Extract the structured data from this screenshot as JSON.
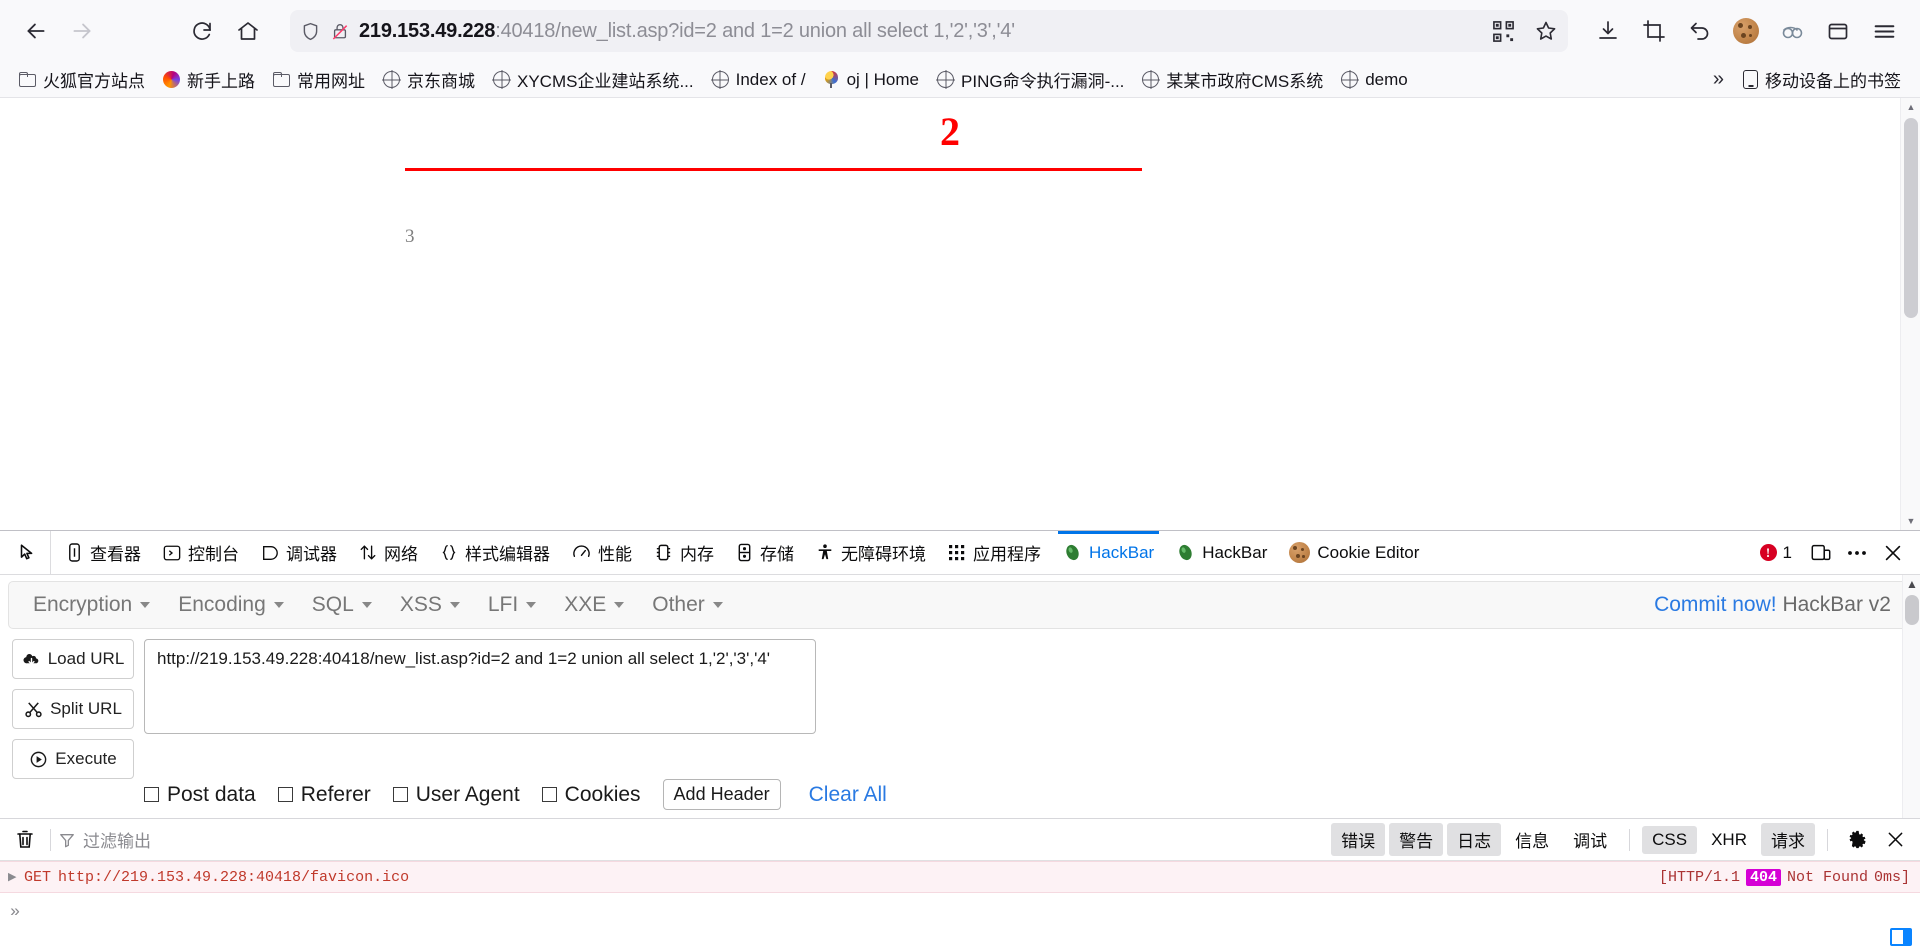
{
  "browser": {
    "url_host": "219.153.49.228",
    "url_rest": ":40418/new_list.asp?id=2 and 1=2 union all select 1,'2','3','4'",
    "back_label": "Back",
    "forward_label": "Forward",
    "reload_label": "Reload",
    "home_label": "Home",
    "downloads_label": "Downloads",
    "screenshot_label": "Take screenshot",
    "undo_label": "Undo close tab",
    "cookie_label": "Cookie Editor",
    "proxy_label": "Proxy",
    "container_label": "Containers",
    "menu_label": "Open application menu",
    "qr_label": "QR code",
    "bookmark_star_label": "Bookmark this page"
  },
  "bookmarks": {
    "items": [
      {
        "label": "火狐官方站点",
        "icon": "folder-icon"
      },
      {
        "label": "新手上路",
        "icon": "firefox-icon"
      },
      {
        "label": "常用网址",
        "icon": "folder-icon"
      },
      {
        "label": "京东商城",
        "icon": "globe-icon"
      },
      {
        "label": "XYCMS企业建站系统...",
        "icon": "globe-icon"
      },
      {
        "label": "Index of /",
        "icon": "globe-icon"
      },
      {
        "label": "oj | Home",
        "icon": "balloon-icon"
      },
      {
        "label": "PING命令执行漏洞-...",
        "icon": "globe-icon"
      },
      {
        "label": "某某市政府CMS系统",
        "icon": "globe-icon"
      },
      {
        "label": "demo",
        "icon": "globe-icon"
      }
    ],
    "overflow_label": "»",
    "mobile_label": "移动设备上的书签"
  },
  "page": {
    "heading": "2",
    "body_text": "3"
  },
  "devtools": {
    "tabs": [
      {
        "label": "查看器",
        "icon": "inspector-icon",
        "active": false
      },
      {
        "label": "控制台",
        "icon": "console-icon",
        "active": false
      },
      {
        "label": "调试器",
        "icon": "debugger-icon",
        "active": false
      },
      {
        "label": "网络",
        "icon": "network-icon",
        "active": false
      },
      {
        "label": "样式编辑器",
        "icon": "style-editor-icon",
        "active": false
      },
      {
        "label": "性能",
        "icon": "performance-icon",
        "active": false
      },
      {
        "label": "内存",
        "icon": "memory-icon",
        "active": false
      },
      {
        "label": "存储",
        "icon": "storage-icon",
        "active": false
      },
      {
        "label": "无障碍环境",
        "icon": "accessibility-icon",
        "active": false
      },
      {
        "label": "应用程序",
        "icon": "application-icon",
        "active": false
      },
      {
        "label": "HackBar",
        "icon": "hackbar-icon",
        "active": true
      },
      {
        "label": "HackBar",
        "icon": "hackbar-icon",
        "active": false
      },
      {
        "label": "Cookie Editor",
        "icon": "cookie-icon",
        "active": false
      }
    ],
    "error_count": "1",
    "picker_label": "选择元素",
    "responsive_label": "响应式设计模式",
    "meatball_label": "自定义工具并获取帮助",
    "close_label": "关闭开发者工具"
  },
  "hackbar": {
    "menu": [
      {
        "label": "Encryption"
      },
      {
        "label": "Encoding"
      },
      {
        "label": "SQL"
      },
      {
        "label": "XSS"
      },
      {
        "label": "LFI"
      },
      {
        "label": "XXE"
      },
      {
        "label": "Other"
      }
    ],
    "commit_link": "Commit now!",
    "commit_suffix": "HackBar v2",
    "buttons": [
      {
        "label": "Load URL",
        "icon": "load-url-icon"
      },
      {
        "label": "Split URL",
        "icon": "split-url-icon"
      },
      {
        "label": "Execute",
        "icon": "execute-icon"
      }
    ],
    "url_value": "http://219.153.49.228:40418/new_list.asp?id=2 and 1=2 union all select 1,'2','3','4'",
    "url_placeholder": "",
    "checkboxes": [
      {
        "label": "Post data",
        "checked": false
      },
      {
        "label": "Referer",
        "checked": false
      },
      {
        "label": "User Agent",
        "checked": false
      },
      {
        "label": "Cookies",
        "checked": false
      }
    ],
    "add_header_label": "Add Header",
    "clear_all_label": "Clear All"
  },
  "console": {
    "clear_label": "清除",
    "filter_placeholder": "过滤输出",
    "filters": [
      {
        "label": "错误",
        "on": true
      },
      {
        "label": "警告",
        "on": true
      },
      {
        "label": "日志",
        "on": true
      },
      {
        "label": "信息",
        "on": false
      },
      {
        "label": "调试",
        "on": false
      }
    ],
    "net_filters": [
      {
        "label": "CSS",
        "on": true
      },
      {
        "label": "XHR",
        "on": false
      },
      {
        "label": "请求",
        "on": true
      }
    ],
    "settings_label": "控制台设置",
    "close_label": "关闭",
    "rows": [
      {
        "method": "GET",
        "url": "http://219.153.49.228:40418/favicon.ico",
        "protocol": "[HTTP/1.1",
        "status": "404",
        "status_text": "Not Found",
        "time": "0ms]"
      }
    ],
    "prompt": "»"
  }
}
